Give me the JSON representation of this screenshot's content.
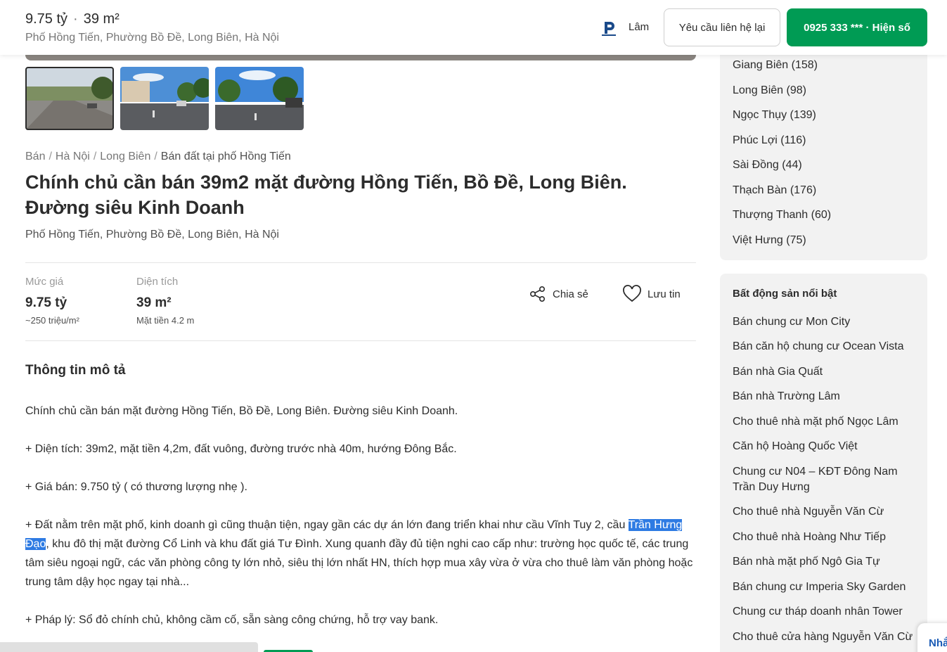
{
  "header": {
    "price": "9.75 tỷ",
    "area": "39 m²",
    "address": "Phố Hồng Tiến, Phường Bồ Đề, Long Biên, Hà Nội",
    "agent_name": "Lâm",
    "contact_label": "Yêu cầu liên hệ lại",
    "phone_label": "0925 333 *** · Hiện số"
  },
  "breadcrumb": [
    "Bán",
    "Hà Nội",
    "Long Biên",
    "Bán đất tại phố Hồng Tiến"
  ],
  "listing": {
    "title": "Chính chủ cần bán 39m2 mặt đường Hồng Tiến, Bồ Đề, Long Biên. Đường siêu Kinh Doanh",
    "address": "Phố Hồng Tiến, Phường Bồ Đề, Long Biên, Hà Nội"
  },
  "stats": {
    "price_label": "Mức giá",
    "price_value": "9.75 tỷ",
    "price_sub": "~250 triệu/m²",
    "area_label": "Diện tích",
    "area_value": "39 m²",
    "area_sub": "Mặt tiền 4.2 m"
  },
  "actions": {
    "share": "Chia sẻ",
    "save": "Lưu tin"
  },
  "description": {
    "title": "Thông tin mô tả",
    "p1": "Chính chủ cần bán mặt đường Hồng Tiến, Bồ Đề, Long Biên. Đường siêu Kinh Doanh.",
    "p2": "+ Diện tích: 39m2, mặt tiền 4,2m, đất vuông, đường trước nhà 40m, hướng Đông Bắc.",
    "p3": "+ Giá bán: 9.750 tỷ ( có thương lượng nhẹ ).",
    "p4_before": "+ Đất nằm trên mặt phố, kinh doanh gì cũng thuận tiện, ngay gần các dự án lớn đang triển khai như cầu Vĩnh Tuy 2, cầu ",
    "p4_highlight": "Trần Hưng Đạo",
    "p4_after": ", khu đô thị mặt đường Cổ Linh và khu đất giá Tư Đình. Xung quanh đầy đủ tiện nghi cao cấp như: trường học quốc tế, các trung tâm siêu ngoại ngữ, các văn phòng công ty lớn nhỏ, siêu thị lớn nhất HN, thích hợp mua xây vừa ở vừa cho thuê làm văn phòng hoặc trung tâm dậy học ngay tại nhà...",
    "p5": "+ Pháp lý: Sổ đỏ chính chủ, không cầm cố, sẵn sàng công chứng, hỗ trợ vay bank."
  },
  "sidebar": {
    "wards": [
      "Giang Biên (158)",
      "Long Biên (98)",
      "Ngọc Thụy (139)",
      "Phúc Lợi (116)",
      "Sài Đồng (44)",
      "Thạch Bàn (176)",
      "Thượng Thanh (60)",
      "Việt Hưng (75)"
    ],
    "featured_title": "Bất động sản nổi bật",
    "featured": [
      "Bán chung cư Mon City",
      "Bán căn hộ chung cư Ocean Vista",
      "Bán nhà Gia Quất",
      "Bán nhà Trường Lâm",
      "Cho thuê nhà mặt phố Ngọc Lâm",
      "Căn hộ Hoàng Quốc Việt",
      "Chung cư N04 – KĐT Đông Nam Trần Duy Hưng",
      "Cho thuê nhà Nguyễn Văn Cừ",
      "Cho thuê nhà Hoàng Như Tiếp",
      "Bán nhà mặt phố Ngô Gia Tự",
      "Bán chung cư Imperia Sky Garden",
      "Chung cư tháp doanh nhân Tower",
      "Cho thuê cửa hàng Nguyễn Văn Cừ"
    ]
  },
  "chat_label": "Nhắ",
  "colors": {
    "accent_green": "#009b54",
    "highlight_blue": "#2e7be3"
  }
}
